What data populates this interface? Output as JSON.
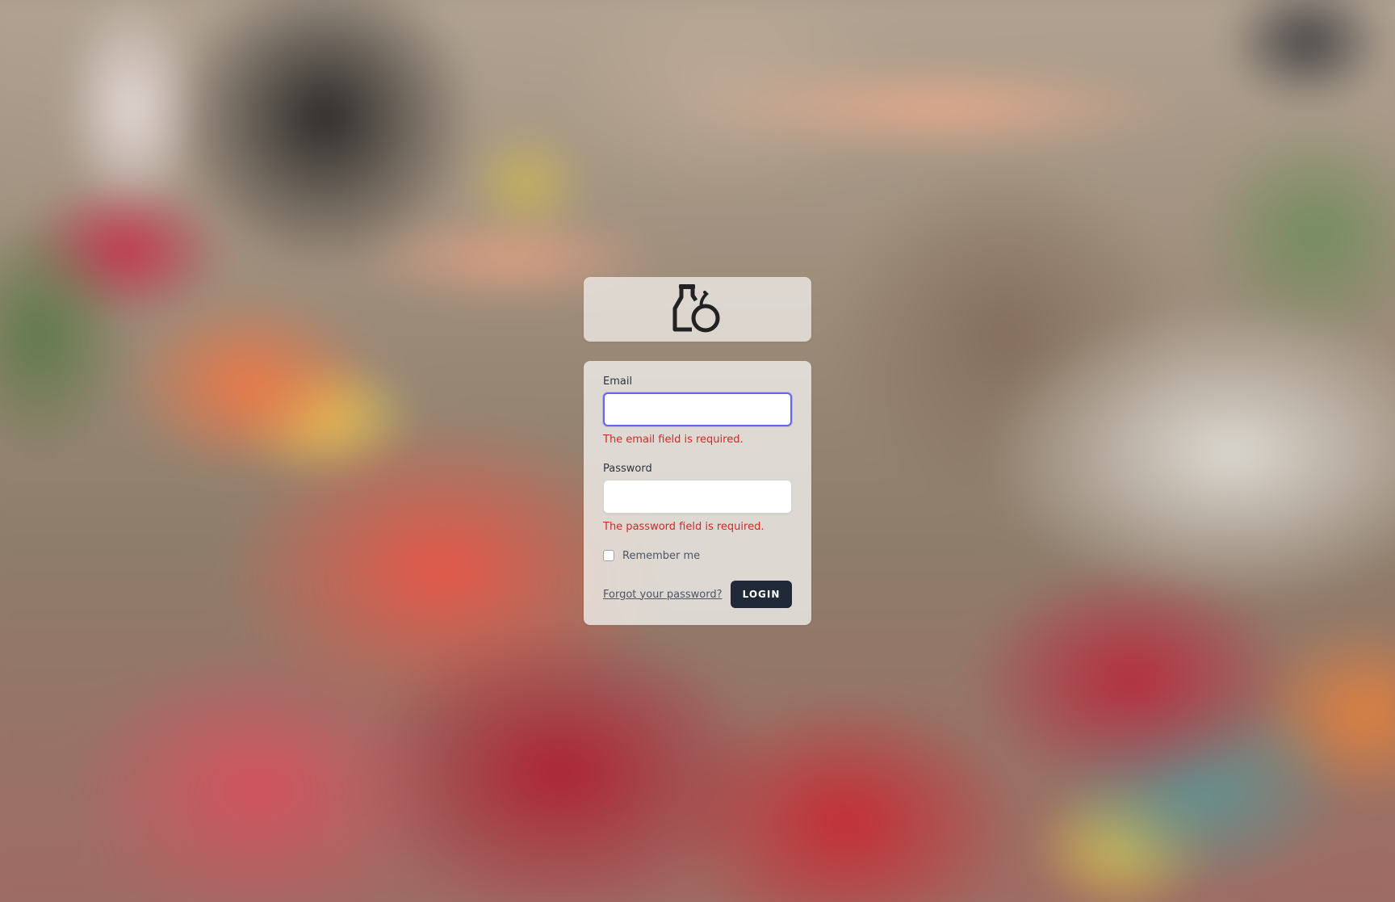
{
  "logo": {
    "icon": "bottle-refresh-icon"
  },
  "form": {
    "email_label": "Email",
    "email_value": "",
    "email_error": "The email field is required.",
    "password_label": "Password",
    "password_value": "",
    "password_error": "The password field is required.",
    "remember_label": "Remember me",
    "remember_checked": false,
    "forgot_link": "Forgot your password?",
    "login_button": "LOGIN"
  },
  "colors": {
    "error": "#dc2626",
    "focus_ring": "#6366f1",
    "button_bg": "#1f2937"
  }
}
